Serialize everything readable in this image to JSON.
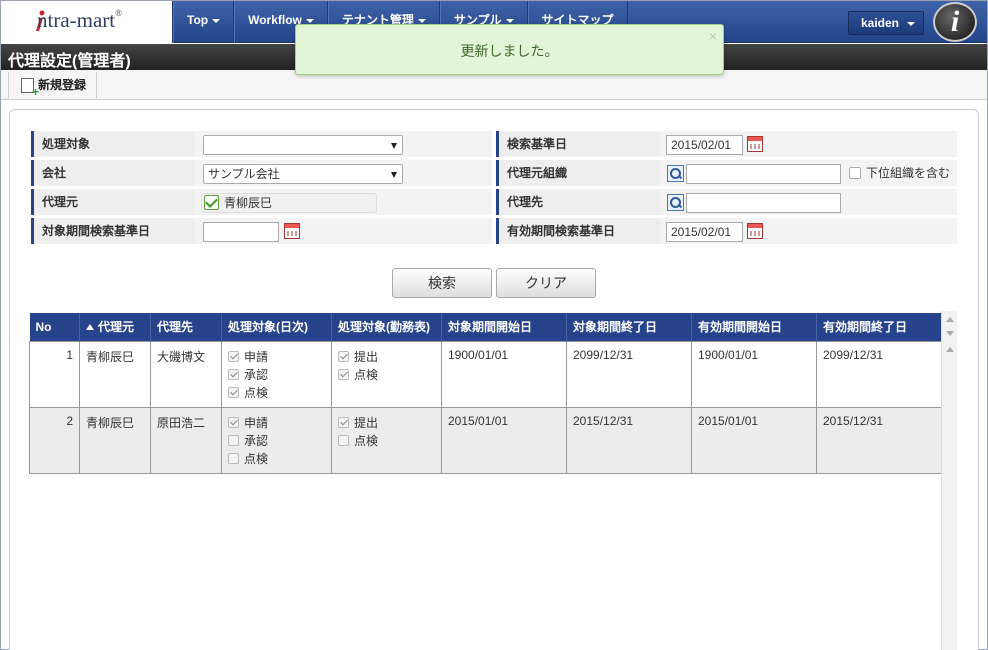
{
  "header": {
    "logo_text": "ntra-mart",
    "logo_reg": "®",
    "nav": [
      "Top",
      "Workflow",
      "テナント管理",
      "サンプル",
      "サイトマップ"
    ],
    "user": "kaiden",
    "brand_glyph": "i"
  },
  "toast": {
    "message": "更新しました。",
    "close": "×"
  },
  "page": {
    "title": "代理設定(管理者)"
  },
  "toolbar": {
    "new_label": "新規登録"
  },
  "form": {
    "shori_taisho_label": "処理対象",
    "shori_taisho_value": "",
    "kaisha_label": "会社",
    "kaisha_value": "サンプル会社",
    "dairimoto_label": "代理元",
    "dairimoto_value": "青柳辰巳",
    "taisho_kijun_label": "対象期間検索基準日",
    "taisho_kijun_value": "",
    "kensaku_kijun_label": "検索基準日",
    "kensaku_kijun_value": "2015/02/01",
    "dairimoto_soshiki_label": "代理元組織",
    "dairimoto_soshiki_value": "",
    "include_sub_label": "下位組織を含む",
    "dairisaki_label": "代理先",
    "dairisaki_value": "",
    "yuko_kijun_label": "有効期間検索基準日",
    "yuko_kijun_value": "2015/02/01"
  },
  "buttons": {
    "search": "検索",
    "clear": "クリア"
  },
  "table": {
    "columns": [
      "No",
      "代理元",
      "代理先",
      "処理対象(日次)",
      "処理対象(勤務表)",
      "対象期間開始日",
      "対象期間終了日",
      "有効期間開始日",
      "有効期間終了日"
    ],
    "rows": [
      {
        "no": "1",
        "from": "青柳辰巳",
        "to": "大磯博文",
        "daily": [
          {
            "label": "申請",
            "checked": true
          },
          {
            "label": "承認",
            "checked": true
          },
          {
            "label": "点検",
            "checked": true
          }
        ],
        "sheet": [
          {
            "label": "提出",
            "checked": true
          },
          {
            "label": "点検",
            "checked": true
          }
        ],
        "t_start": "1900/01/01",
        "t_end": "2099/12/31",
        "v_start": "1900/01/01",
        "v_end": "2099/12/31"
      },
      {
        "no": "2",
        "from": "青柳辰巳",
        "to": "原田浩二",
        "daily": [
          {
            "label": "申請",
            "checked": true
          },
          {
            "label": "承認",
            "checked": false
          },
          {
            "label": "点検",
            "checked": false
          }
        ],
        "sheet": [
          {
            "label": "提出",
            "checked": true
          },
          {
            "label": "点検",
            "checked": false
          }
        ],
        "t_start": "2015/01/01",
        "t_end": "2015/12/31",
        "v_start": "2015/01/01",
        "v_end": "2015/12/31"
      }
    ]
  }
}
